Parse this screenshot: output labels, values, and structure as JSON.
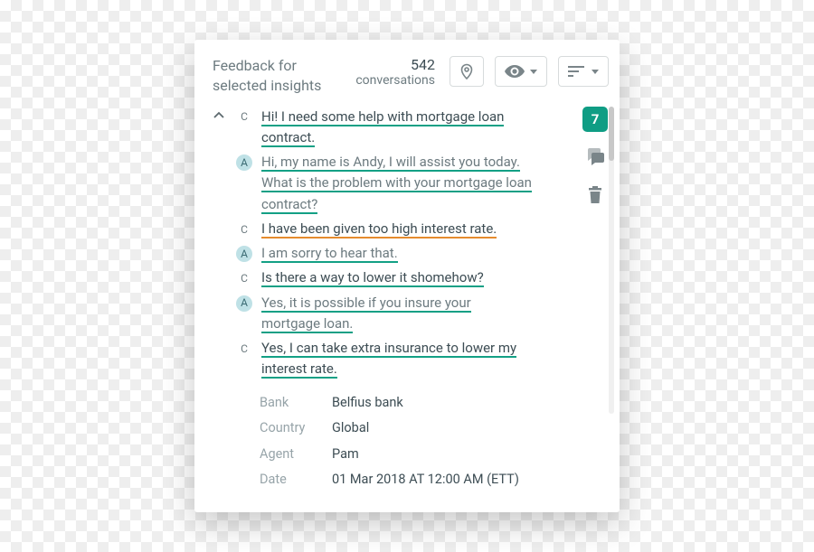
{
  "header": {
    "title": "Feedback for selected insights",
    "count": "542",
    "count_label": "conversations"
  },
  "sidebar": {
    "badge": "7"
  },
  "messages": [
    {
      "speaker": "C",
      "role": "cust",
      "lines": [
        "Hi! I need some help with mortgage loan",
        "contract."
      ]
    },
    {
      "speaker": "A",
      "role": "agent",
      "lines": [
        "Hi, my name is Andy, I will assist you today.",
        "What is the problem with your mortgage loan",
        "contract?"
      ]
    },
    {
      "speaker": "C",
      "role": "cust",
      "lines": [
        "I have been given too high interest rate."
      ],
      "warn": true
    },
    {
      "speaker": "A",
      "role": "agent",
      "lines": [
        "I am sorry to hear that."
      ]
    },
    {
      "speaker": "C",
      "role": "cust",
      "lines": [
        "Is there a way to lower it shomehow?"
      ]
    },
    {
      "speaker": "A",
      "role": "agent",
      "lines": [
        "Yes, it is possible if you insure your",
        "mortgage loan."
      ]
    },
    {
      "speaker": "C",
      "role": "cust",
      "lines": [
        "Yes, I can take extra insurance to lower my",
        "interest rate."
      ]
    }
  ],
  "meta": [
    {
      "label": "Bank",
      "value": "Belfius bank"
    },
    {
      "label": "Country",
      "value": "Global"
    },
    {
      "label": "Agent",
      "value": "Pam"
    },
    {
      "label": "Date",
      "value": "01 Mar 2018 AT 12:00 AM (ETT)"
    }
  ]
}
